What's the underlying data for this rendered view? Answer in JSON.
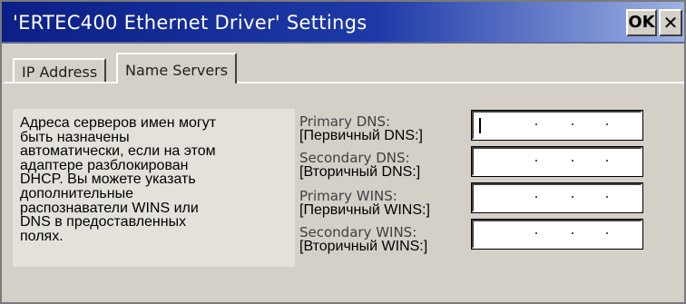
{
  "window": {
    "title": "'ERTEC400 Ethernet Driver' Settings",
    "ok_label": "OK",
    "close_label": "✕"
  },
  "tabs": [
    {
      "label": "IP Address",
      "active": false
    },
    {
      "label": "Name Servers",
      "active": true
    }
  ],
  "description": [
    "Адреса серверов имен могут",
    "быть назначены",
    "автоматически, если на этом",
    "адаптере разблокирован",
    "DHCP. Вы можете указать",
    "дополнительные",
    "распознаватели WINS или",
    "DNS в предоставленных",
    "полях."
  ],
  "fields": [
    {
      "label_en": "Primary DNS:",
      "label_ru": "[Первичный DNS:]",
      "value": ""
    },
    {
      "label_en": "Secondary DNS:",
      "label_ru": "[Вторичный DNS:]",
      "value": ""
    },
    {
      "label_en": "Primary WINS:",
      "label_ru": "[Первичный WINS:]",
      "value": ""
    },
    {
      "label_en": "Secondary WINS:",
      "label_ru": "[Вторичный WINS:]",
      "value": ""
    }
  ],
  "colors": {
    "titlebar_start": "#0b1f86",
    "titlebar_end": "#9fb2e4",
    "dialog_bg": "#d4d0c8"
  }
}
